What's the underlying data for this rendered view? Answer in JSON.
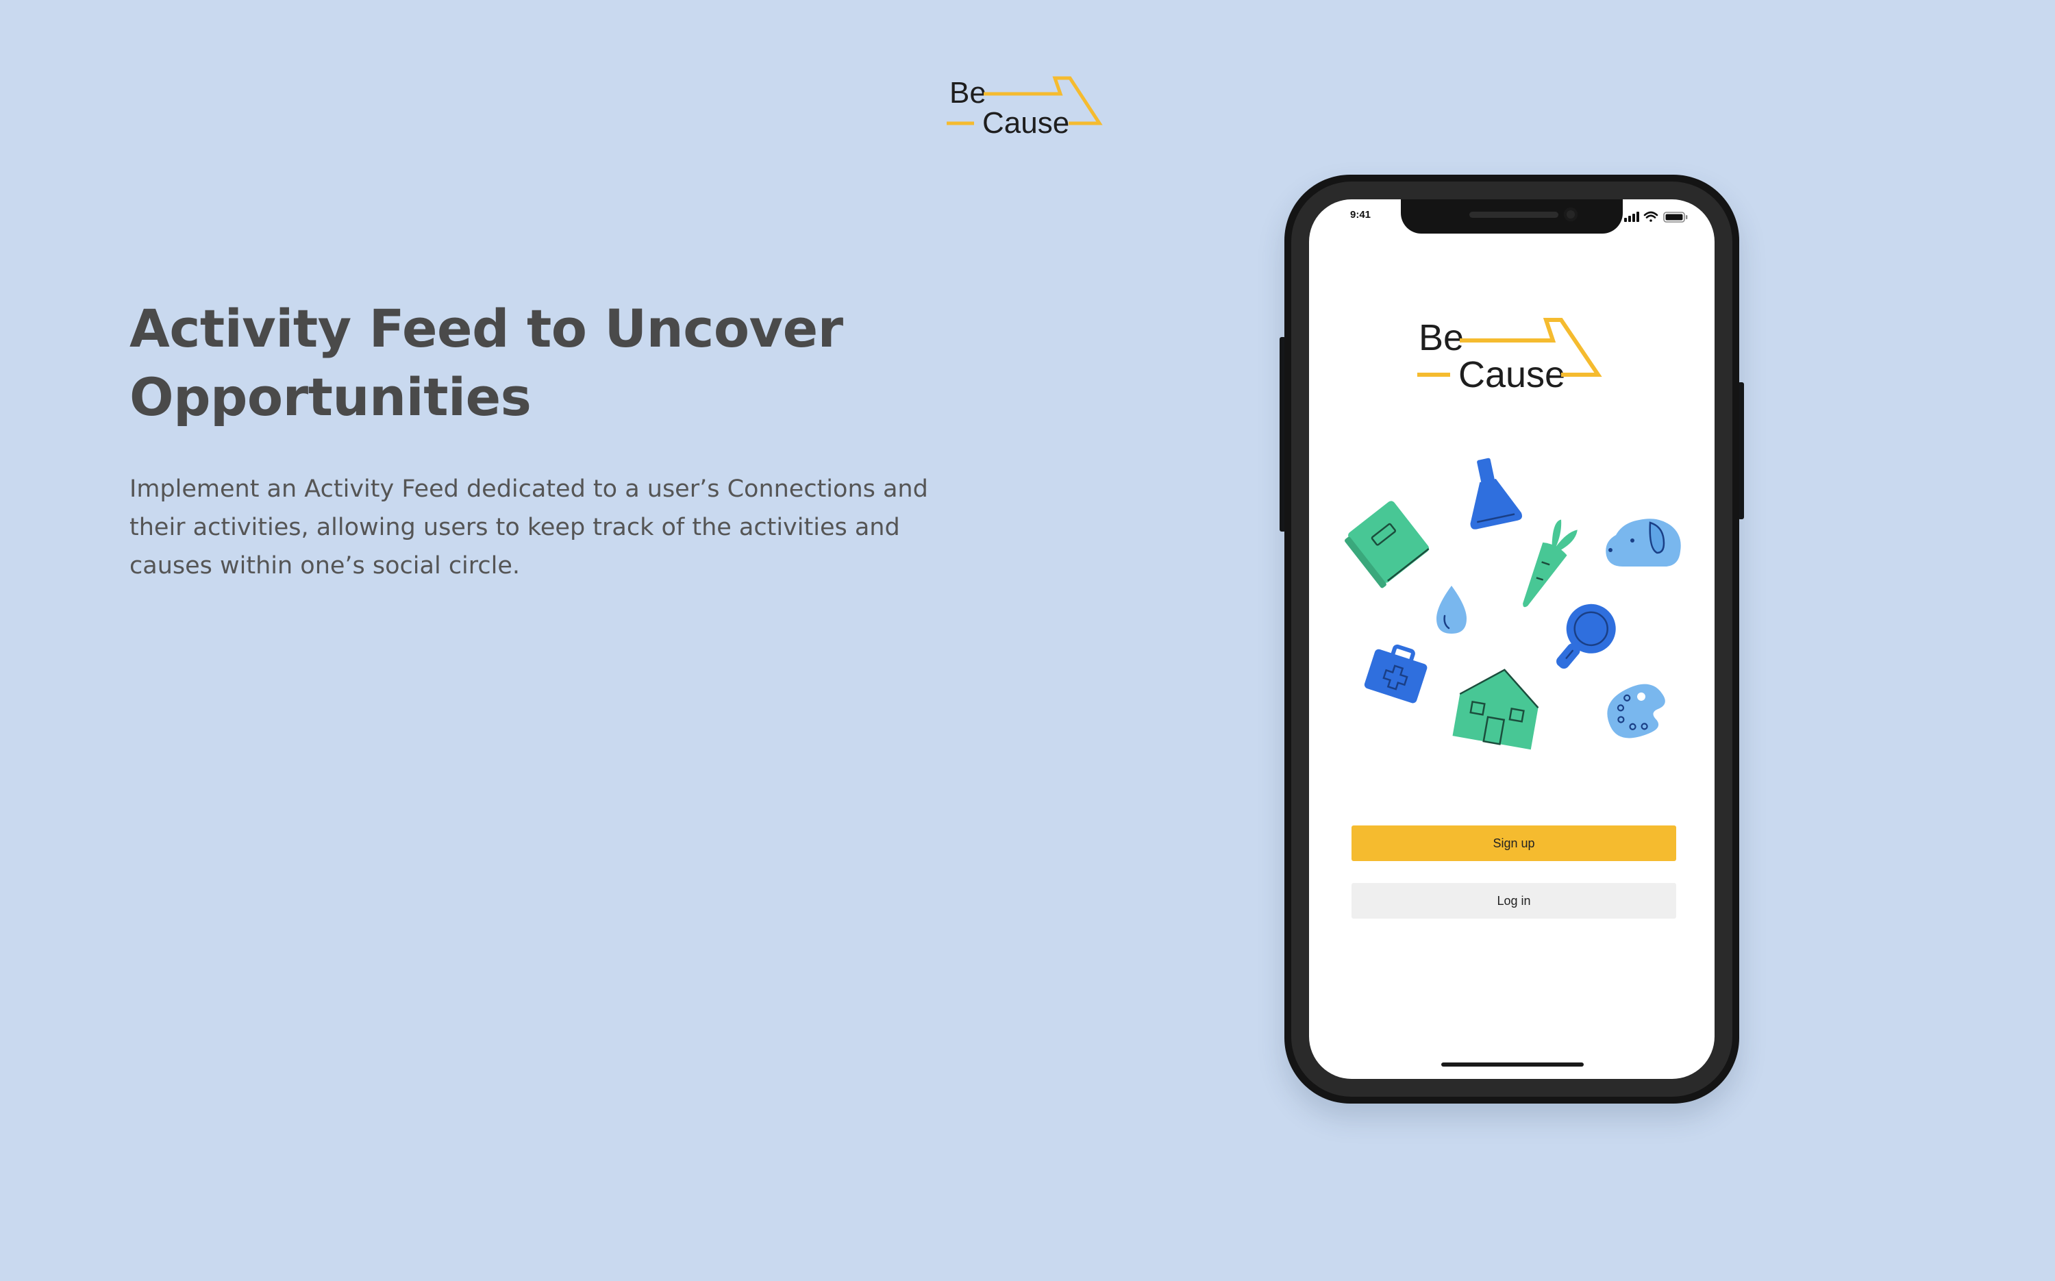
{
  "brand": {
    "line1": "Be",
    "line2": "Cause",
    "accent_color": "#f5bb2f",
    "text_color": "#1e1e1e"
  },
  "page": {
    "headline": "Activity Feed to Uncover Opportunities",
    "description": "Implement an Activity Feed dedicated to a user’s Connections and their activities, allowing users to keep track of the activities and causes within one’s social circle.",
    "background_color": "#c9d9ef"
  },
  "phone": {
    "status_time": "9:41",
    "status_icons": [
      "cellular-signal-icon",
      "wifi-icon",
      "battery-icon"
    ],
    "illustration_icons": [
      "book-icon",
      "flask-icon",
      "carrot-icon",
      "dog-icon",
      "water-drop-icon",
      "magnifier-icon",
      "first-aid-kit-icon",
      "house-icon",
      "paint-palette-icon"
    ],
    "colors": {
      "green": "#48c795",
      "blue": "#2f6fde",
      "light_blue": "#79b7ee"
    },
    "signup_label": "Sign up",
    "login_label": "Log in"
  }
}
